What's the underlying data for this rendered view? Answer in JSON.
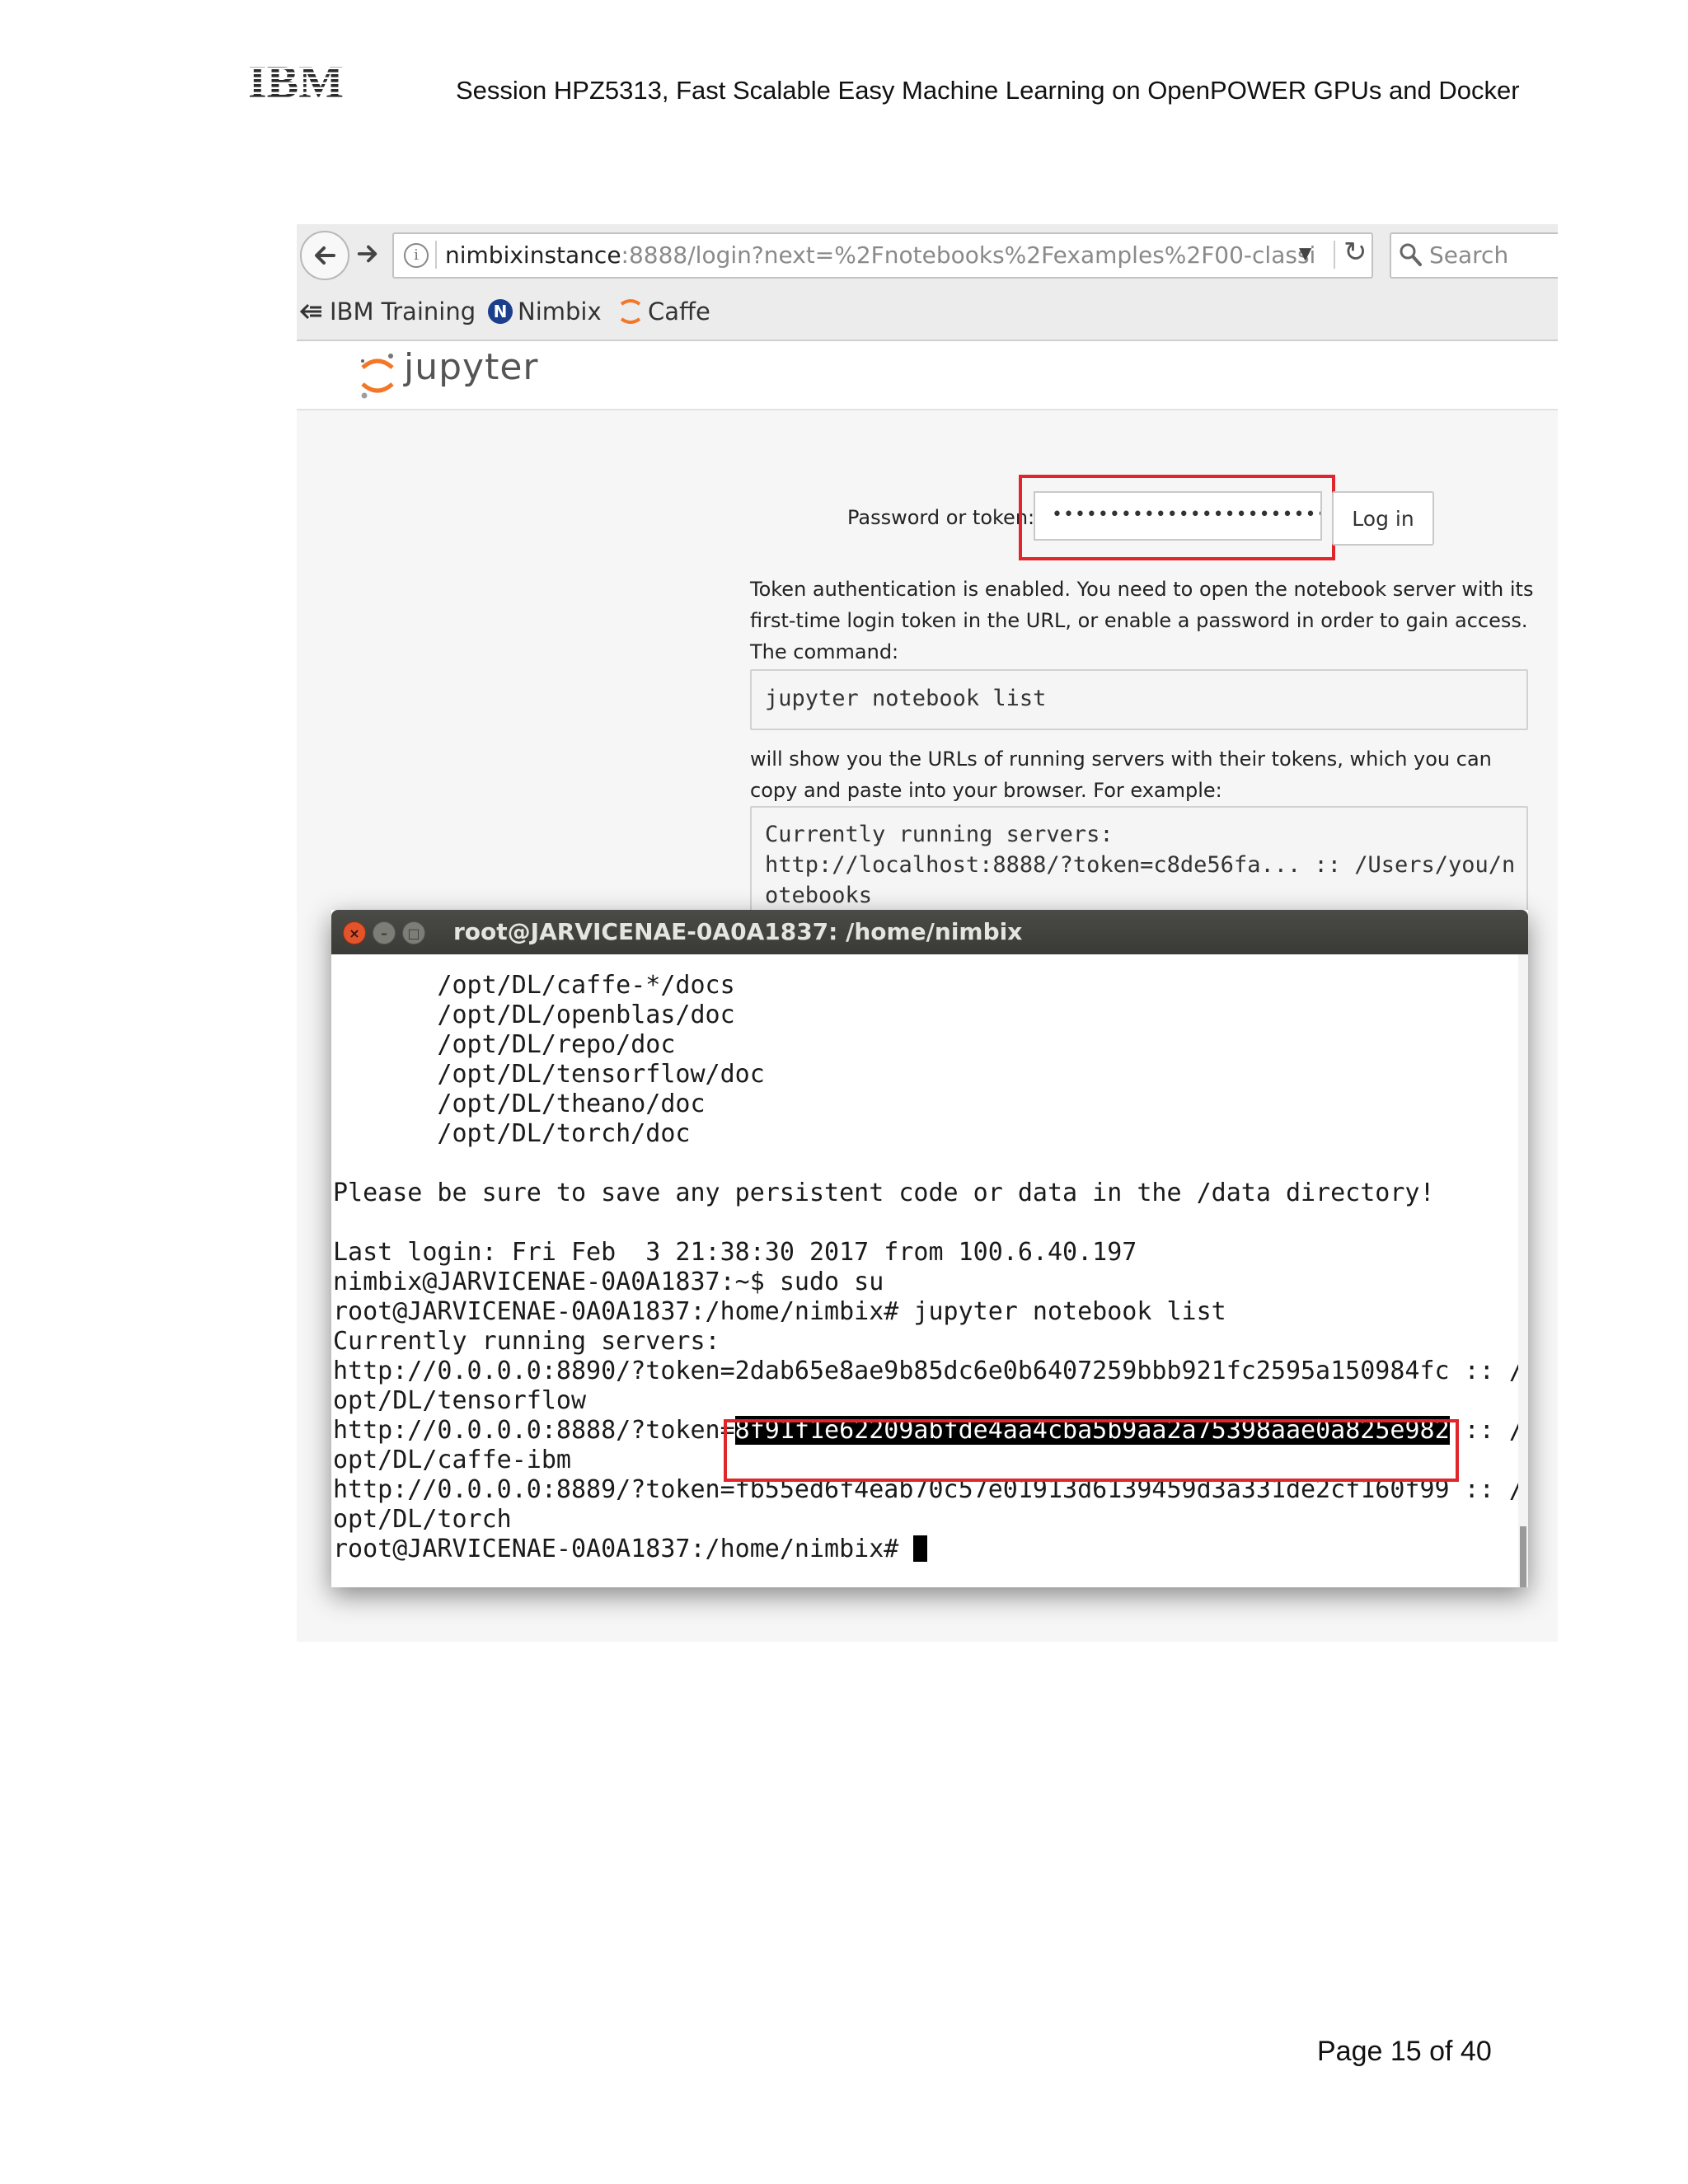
{
  "header": {
    "logo_text": "IBM",
    "title": "Session HPZ5313, Fast Scalable Easy Machine Learning on OpenPOWER GPUs and Docker"
  },
  "browser": {
    "url_host": "nimbixinstance",
    "url_path": ":8888/login?next=%2Fnotebooks%2Fexamples%2F00-classi",
    "search_placeholder": "Search",
    "icons": [
      "back-icon",
      "forward-icon",
      "info-icon",
      "dropdown-icon",
      "reload-icon",
      "search-icon"
    ],
    "bookmarks": [
      {
        "label": "IBM Training",
        "icon": "ibm-training-icon"
      },
      {
        "label": "Nimbix",
        "icon": "nimbix-icon"
      },
      {
        "label": "Caffe",
        "icon": "caffe-icon"
      }
    ]
  },
  "jupyter": {
    "name": "jupyter",
    "password_label": "Password or token:",
    "password_value": "••••••••••••••••••••••••••••••••",
    "login_label": "Log in",
    "help_p1": "Token authentication is enabled. You need to open the notebook server with its first-time login token in the URL, or enable a password in order to gain access. The command:",
    "command": "jupyter notebook list",
    "help_p2": "will show you the URLs of running servers with their tokens, which you can copy and paste into your browser. For example:",
    "example_lines": [
      "Currently running servers:",
      "http://localhost:8888/?token=c8de56fa... :: /Users/you/n",
      "otebooks"
    ]
  },
  "terminal": {
    "title": "root@JARVICENAE-0A0A1837: /home/nimbix",
    "lines": [
      "       /opt/DL/caffe-*/docs",
      "       /opt/DL/openblas/doc",
      "       /opt/DL/repo/doc",
      "       /opt/DL/tensorflow/doc",
      "       /opt/DL/theano/doc",
      "       /opt/DL/torch/doc",
      "",
      "Please be sure to save any persistent code or data in the /data directory!",
      "",
      "Last login: Fri Feb  3 21:38:30 2017 from 100.6.40.197",
      "nimbix@JARVICENAE-0A0A1837:~$ sudo su",
      "root@JARVICENAE-0A0A1837:/home/nimbix# jupyter notebook list",
      "Currently running servers:",
      "http://0.0.0.0:8890/?token=2dab65e8ae9b85dc6e0b6407259bbb921fc2595a150984fc :: /",
      "opt/DL/tensorflow"
    ],
    "token_line_prefix": "http://0.0.0.0:8888/?token=",
    "token_value": "8f91f1e62209abfde4aa4cba5b9aa2a75398aae0a825e982",
    "token_line_suffix": " :: /",
    "lines_after": [
      "opt/DL/caffe-ibm",
      "http://0.0.0.0:8889/?token=fb55ed6f4eab70c57e01913d6139459d3a331de2cf160f99 :: /",
      "opt/DL/torch"
    ],
    "prompt": "root@JARVICENAE-0A0A1837:/home/nimbix# "
  },
  "footer": {
    "page_number": "Page 15 of 40"
  },
  "colors": {
    "highlight_red": "#e0262b",
    "terminal_titlebar": "#3e3e3b",
    "close_button": "#e3542b",
    "jupyter_orange": "#f37726"
  }
}
